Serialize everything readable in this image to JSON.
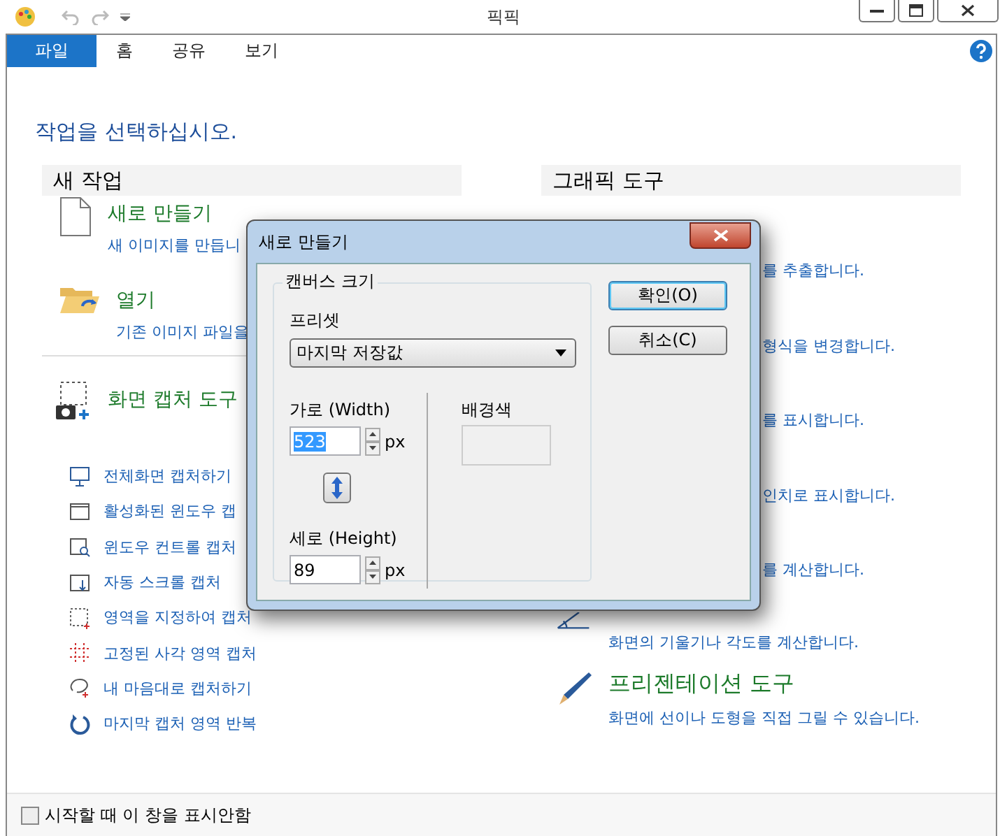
{
  "window": {
    "title": "픽픽"
  },
  "menu_tabs": [
    {
      "label": "파일",
      "selected": true
    },
    {
      "label": "홈",
      "selected": false
    },
    {
      "label": "공유",
      "selected": false
    },
    {
      "label": "보기",
      "selected": false
    }
  ],
  "prompt": "작업을 선택하십시오.",
  "new_work": {
    "heading": "새 작업",
    "items": [
      {
        "kind": "new",
        "title": "새로 만들기",
        "description": "새 이미지를 만듭니"
      },
      {
        "kind": "open",
        "title": "열기",
        "description": "기존 이미지 파일을"
      }
    ],
    "capture": {
      "title": "화면 캡처 도구",
      "items": [
        {
          "kind": "fullscreen",
          "label": "전체화면 캡처하기"
        },
        {
          "kind": "window",
          "label": "활성화된 윈도우 캡"
        },
        {
          "kind": "control",
          "label": "윈도우 컨트롤 캡처"
        },
        {
          "kind": "scroll",
          "label": "자동 스크롤 캡처"
        },
        {
          "kind": "region",
          "label": "영역을 지정하여 캡처"
        },
        {
          "kind": "fixed",
          "label": "고정된 사각 영역 캡처"
        },
        {
          "kind": "freehand",
          "label": "내 마음대로 캡처하기"
        },
        {
          "kind": "repeat",
          "label": "마지막 캡처 영역 반복"
        }
      ]
    }
  },
  "graphic_tools": {
    "heading": "그래픽 도구",
    "items": [
      {
        "kind": "covered",
        "description": "를 추출합니다."
      },
      {
        "kind": "covered",
        "description": "형식을 변경합니다."
      },
      {
        "kind": "covered",
        "description": "를 표시합니다."
      },
      {
        "kind": "covered",
        "description": "인치로 표시합니다."
      },
      {
        "kind": "covered",
        "description": "를 계산합니다."
      },
      {
        "kind": "protractor",
        "description": "화면의 기울기나 각도를 계산합니다."
      },
      {
        "kind": "pen",
        "title": "프리젠테이션 도구",
        "description": "화면에 선이나 도형을 직접 그릴 수 있습니다."
      }
    ]
  },
  "footer": {
    "label": "시작할 때 이 창을 표시안함",
    "checked": false
  },
  "dialog": {
    "title": "새로 만들기",
    "group_label": "캔버스 크기",
    "preset_label": "프리셋",
    "preset_value": "마지막 저장값",
    "width_label": "가로 (Width)",
    "width_value": "523",
    "width_text_selected": true,
    "width_unit": "px",
    "height_label": "세로 (Height)",
    "height_value": "89",
    "height_unit": "px",
    "background_label": "배경색",
    "buttons": [
      {
        "label": "확인(O)",
        "default": true
      },
      {
        "label": "취소(C)",
        "default": false
      }
    ]
  }
}
